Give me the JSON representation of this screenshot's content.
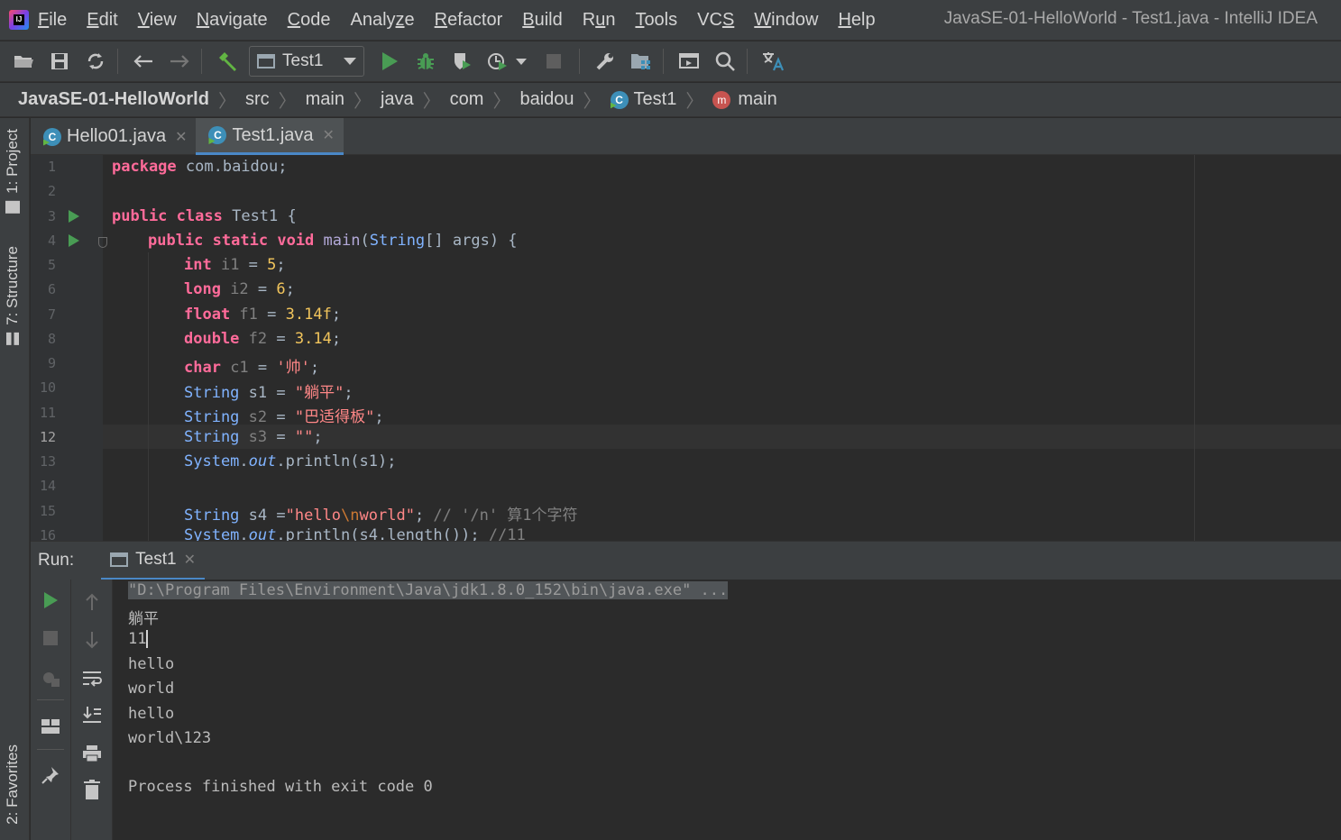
{
  "menubar": {
    "items": [
      {
        "label": "File",
        "u": "F",
        "rest": "ile"
      },
      {
        "label": "Edit",
        "u": "E",
        "rest": "dit"
      },
      {
        "label": "View",
        "u": "V",
        "rest": "iew"
      },
      {
        "label": "Navigate",
        "u": "N",
        "rest": "avigate"
      },
      {
        "label": "Code",
        "u": "C",
        "rest": "ode"
      },
      {
        "label": "Analyze",
        "pre": "Analy",
        "u": "z",
        "rest": "e"
      },
      {
        "label": "Refactor",
        "u": "R",
        "rest": "efactor"
      },
      {
        "label": "Build",
        "u": "B",
        "rest": "uild"
      },
      {
        "label": "Run",
        "pre": "R",
        "u": "u",
        "rest": "n"
      },
      {
        "label": "Tools",
        "u": "T",
        "rest": "ools"
      },
      {
        "label": "VCS",
        "pre": "VC",
        "u": "S",
        "rest": ""
      },
      {
        "label": "Window",
        "u": "W",
        "rest": "indow"
      },
      {
        "label": "Help",
        "u": "H",
        "rest": "elp"
      }
    ],
    "window_title": "JavaSE-01-HelloWorld - Test1.java - IntelliJ IDEA",
    "logo_text": "IJ"
  },
  "toolbar": {
    "run_config": "Test1"
  },
  "breadcrumb": [
    "JavaSE-01-HelloWorld",
    "src",
    "main",
    "java",
    "com",
    "baidou",
    "Test1",
    "main"
  ],
  "left_strip": {
    "project": "1: Project",
    "structure": "7: Structure",
    "favorites": "2: Favorites"
  },
  "editor_tabs": [
    {
      "label": "Hello01.java",
      "active": false
    },
    {
      "label": "Test1.java",
      "active": true
    }
  ],
  "editor": {
    "line_numbers": [
      "1",
      "2",
      "3",
      "4",
      "5",
      "6",
      "7",
      "8",
      "9",
      "10",
      "11",
      "12",
      "13",
      "14",
      "15",
      "16"
    ],
    "current_line": "12",
    "code": {
      "l1_kw": "package",
      "l1_rest": " com.baidou;",
      "l3_kw1": "public",
      "l3_kw2": "class",
      "l3_name": " Test1 {",
      "l4_kw1": "public",
      "l4_kw2": "static",
      "l4_kw3": "void",
      "l4_fn": "main",
      "l4_p1": "(",
      "l4_type": "String",
      "l4_rest": "[] args) {",
      "l5_kw": "int",
      "l5_var": " i1",
      "l5_eq": " = ",
      "l5_val": "5",
      "l5_end": ";",
      "l6_kw": "long",
      "l6_var": " i2",
      "l6_eq": " = ",
      "l6_val": "6",
      "l6_end": ";",
      "l7_kw": "float",
      "l7_var": " f1",
      "l7_eq": " = ",
      "l7_val": "3.14f",
      "l7_end": ";",
      "l8_kw": "double",
      "l8_var": " f2",
      "l8_eq": " = ",
      "l8_val": "3.14",
      "l8_end": ";",
      "l9_kw": "char",
      "l9_var": " c1",
      "l9_eq": " = ",
      "l9_val": "'帅'",
      "l9_end": ";",
      "l10_type": "String",
      "l10_var": " s1",
      "l10_eq": " = ",
      "l10_val": "\"躺平\"",
      "l10_end": ";",
      "l11_type": "String",
      "l11_var": " s2",
      "l11_eq": " = ",
      "l11_val": "\"巴适得板\"",
      "l11_end": ";",
      "l12_type": "String",
      "l12_var": " s3",
      "l12_eq": " = ",
      "l12_val": "\"\"",
      "l12_end": ";",
      "l13_cls": "System",
      "l13_dot": ".",
      "l13_fld": "out",
      "l13_rest": ".println(s1);",
      "l15_type": "String",
      "l15_var": " s4 =",
      "l15_s1": "\"hello",
      "l15_esc": "\\n",
      "l15_s2": "world\"",
      "l15_end": "; ",
      "l15_cmt": "// '/n' 算1个字符",
      "l16_cls": "System",
      "l16_dot": ".",
      "l16_fld": "out",
      "l16_rest": ".println(s4.length()); ",
      "l16_cmt": "//11"
    }
  },
  "run_panel": {
    "label": "Run:",
    "tab": "Test1",
    "console": [
      "\"D:\\Program Files\\Environment\\Java\\jdk1.8.0_152\\bin\\java.exe\" ...",
      "躺平",
      "11",
      "hello",
      "world",
      "hello",
      "world\\123",
      "",
      "Process finished with exit code 0"
    ]
  },
  "colors": {
    "background": "#2b2b2b",
    "panel": "#3c3f41",
    "run_green": "#499c54",
    "accent_blue": "#4a88c7"
  }
}
